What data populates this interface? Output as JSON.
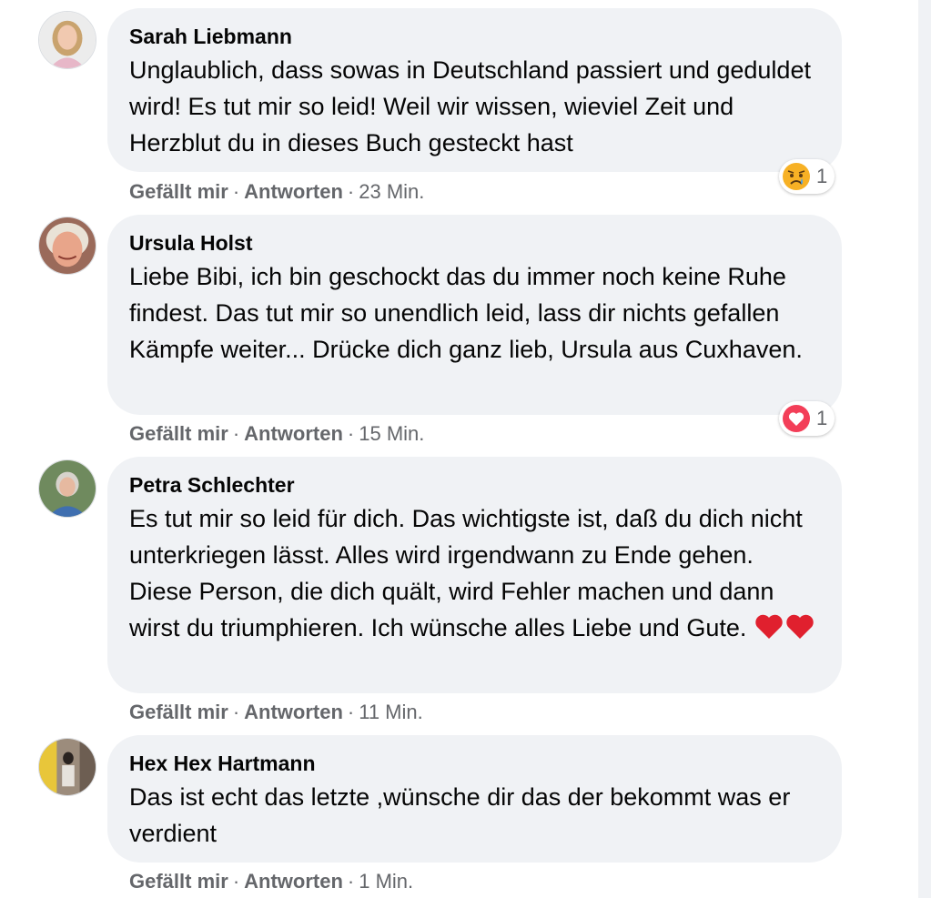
{
  "comments": [
    {
      "author": "Sarah Liebmann",
      "text": "Unglaublich, dass sowas in Deutschland passiert und geduldet wird! Es tut mir so leid! Weil wir wissen, wieviel Zeit und Herzblut du in dieses Buch gesteckt hast",
      "reaction": {
        "icon": "sad-reaction-icon",
        "count": "1"
      },
      "like_label": "Gefällt mir",
      "reply_label": "Antworten",
      "time": "23 Min."
    },
    {
      "author": "Ursula Holst",
      "text": "Liebe Bibi, ich bin geschockt das du immer noch keine Ruhe findest. Das tut mir so unendlich leid, lass dir nichts gefallen Kämpfe weiter... Drücke dich ganz lieb, Ursula aus Cuxhaven.",
      "reaction": {
        "icon": "love-reaction-icon",
        "count": "1"
      },
      "like_label": "Gefällt mir",
      "reply_label": "Antworten",
      "time": "15 Min."
    },
    {
      "author": "Petra Schlechter",
      "text": "Es tut mir so leid für dich. Das wichtigste ist, daß du dich nicht unterkriegen lässt. Alles wird irgendwann zu Ende gehen. Diese Person, die dich quält, wird Fehler machen und dann wirst du triumphieren. Ich wünsche alles Liebe und Gute.",
      "emoji_suffix": "red-heart-emoji x2",
      "like_label": "Gefällt mir",
      "reply_label": "Antworten",
      "time": "11 Min."
    },
    {
      "author": "Hex Hex Hartmann",
      "text": "Das ist echt das letzte ,wünsche dir das der bekommt was er verdient",
      "like_label": "Gefällt mir",
      "reply_label": "Antworten",
      "time": "1 Min."
    }
  ],
  "separator": "·",
  "colors": {
    "bubble": "#f0f2f5",
    "text": "#050505",
    "meta": "#65676b",
    "sad": "#f7b125",
    "love": "#f33e58"
  }
}
